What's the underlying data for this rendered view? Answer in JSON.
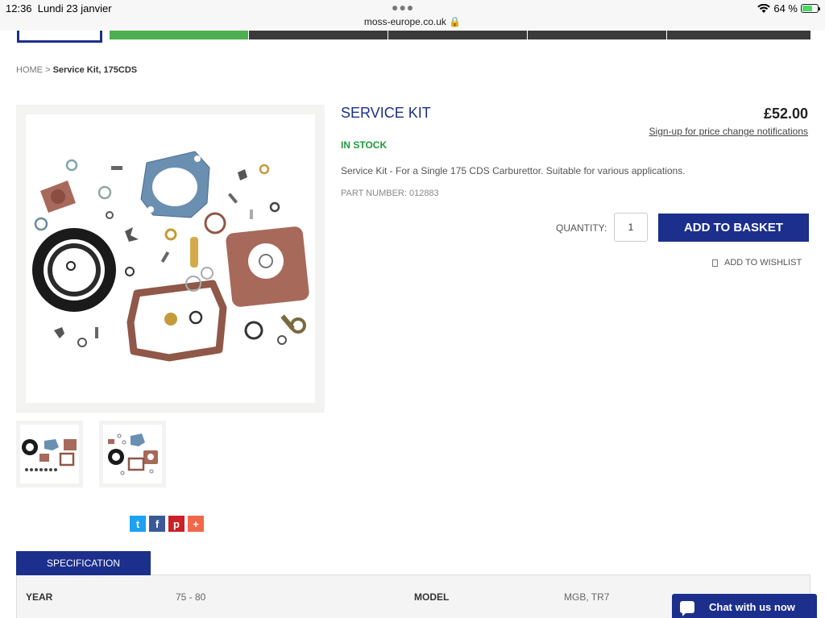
{
  "status_bar": {
    "time": "12:36",
    "date": "Lundi 23 janvier",
    "url": "moss-europe.co.uk",
    "battery": "64 %"
  },
  "breadcrumb": {
    "home": "HOME",
    "separator": ">",
    "current": "Service Kit, 175CDS"
  },
  "product": {
    "title": "SERVICE KIT",
    "price": "£52.00",
    "price_notify": "Sign-up for price change notifications",
    "stock": "IN STOCK",
    "description": "Service Kit - For a Single 175 CDS Carburettor. Suitable for various applications.",
    "part_number": "PART NUMBER: 012883",
    "quantity_label": "QUANTITY:",
    "quantity_value": "1",
    "add_to_basket": "ADD TO BASKET",
    "add_to_wishlist": "ADD TO WISHLIST"
  },
  "share": {
    "twitter": "t",
    "facebook": "f",
    "pinterest": "p",
    "more": "+"
  },
  "specification": {
    "tab": "SPECIFICATION",
    "rows": [
      {
        "key": "YEAR",
        "value": "75 - 80"
      },
      {
        "key": "MODEL",
        "value": "MGB, TR7"
      }
    ]
  },
  "chat": {
    "label": "Chat with us now"
  },
  "colors": {
    "brand_blue": "#1c2f8c",
    "stock_green": "#1f9a3a",
    "nav_green": "#4caf50",
    "twitter": "#1da1f2",
    "facebook": "#3b5998",
    "pinterest": "#cb2027",
    "more": "#f0674a"
  }
}
